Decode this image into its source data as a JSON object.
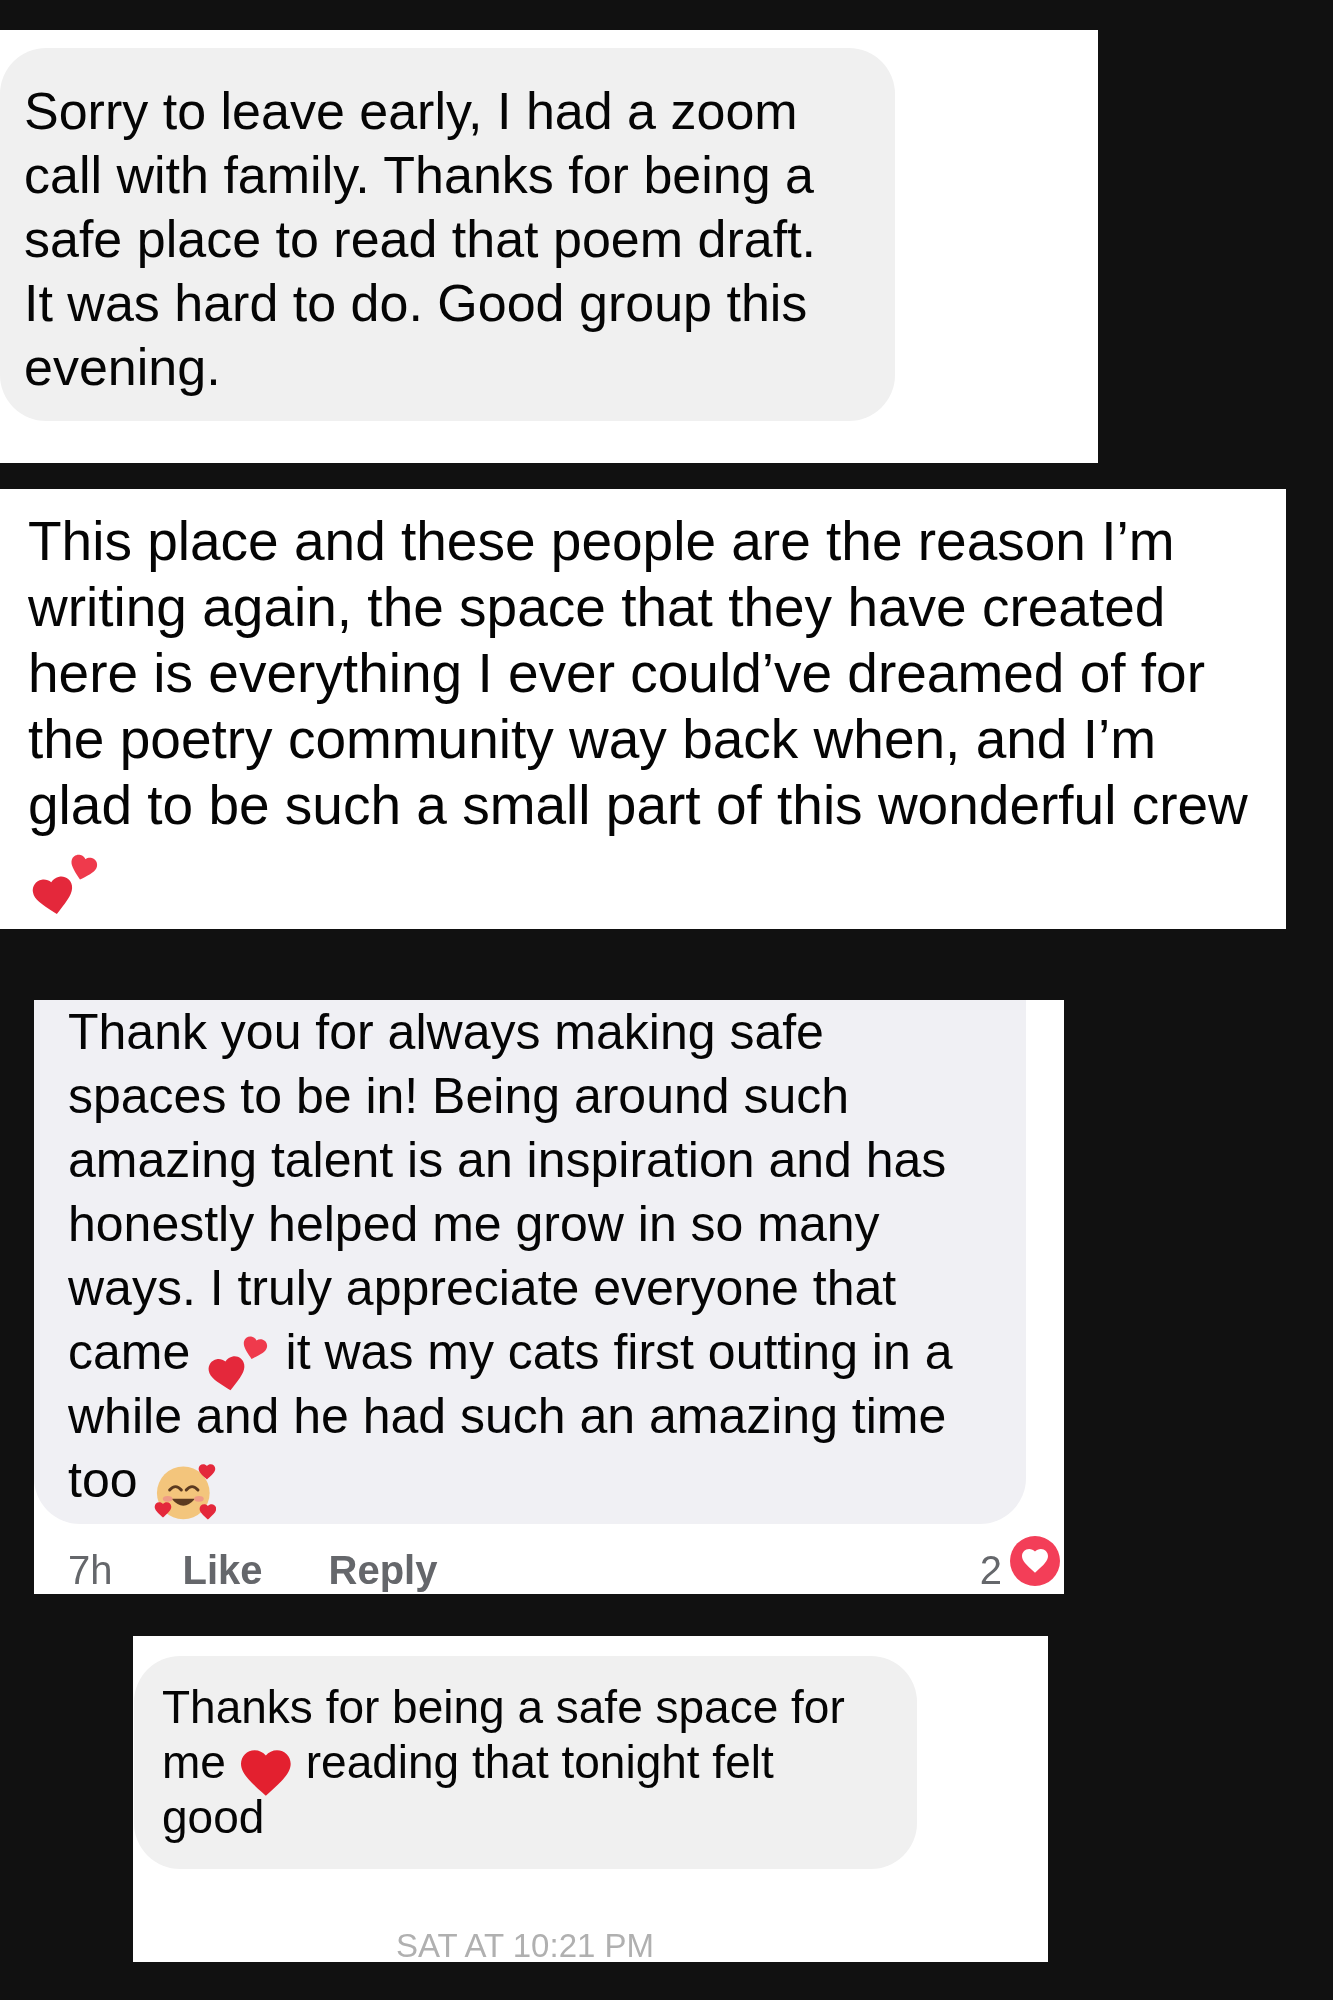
{
  "screenshots": [
    {
      "kind": "bubble",
      "segments": [
        {
          "kind": "text",
          "text": "Sorry to leave early, I had a zoom call with family. Thanks for being a safe place to read that poem draft. It was hard to do. Good group this evening."
        }
      ]
    },
    {
      "kind": "plain",
      "segments": [
        {
          "kind": "text",
          "text": "This place and these people are the reason I’m writing again, the space that they have created here is everything I ever could’ve dreamed of for the poetry community way back when, and I’m glad to be such a small part of this wonderful crew"
        },
        {
          "kind": "hearts"
        }
      ]
    },
    {
      "kind": "bubble",
      "segments": [
        {
          "kind": "text",
          "text": "Thank you for always making safe spaces to be in! Being around such amazing talent is an inspiration and has honestly helped me grow in so many ways. I truly appreciate everyone that came"
        },
        {
          "kind": "hearts"
        },
        {
          "kind": "text",
          "text": "it was my cats first outting in a while and he had such an amazing time too"
        },
        {
          "kind": "blush"
        }
      ],
      "footer": {
        "time": "7h",
        "like": "Like",
        "reply": "Reply",
        "reaction_count": "2"
      }
    },
    {
      "kind": "bubble",
      "segments": [
        {
          "kind": "text",
          "text": "Thanks for being a safe space for me"
        },
        {
          "kind": "heart"
        },
        {
          "kind": "text",
          "text": "reading that tonight felt good"
        }
      ],
      "timestamp": "SAT AT 10:21 PM"
    }
  ]
}
